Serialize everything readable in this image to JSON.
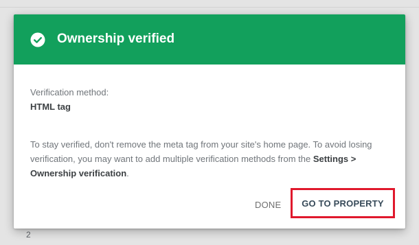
{
  "background": {
    "page_number": "2"
  },
  "dialog": {
    "title": "Ownership verified",
    "header_color": "#12a05c",
    "method_label": "Verification method:",
    "method_value": "HTML tag",
    "description": {
      "text_part1": "To stay verified, don't remove the meta tag from your site's home page. To avoid losing verification, you may want to add multiple verification methods from the ",
      "bold_part": "Settings > Ownership verification",
      "text_part2": "."
    },
    "buttons": {
      "done_label": "DONE",
      "go_to_property_label": "GO TO PROPERTY"
    },
    "highlight_color": "#e0182c",
    "icons": {
      "header_icon": "check-circle-icon"
    }
  }
}
